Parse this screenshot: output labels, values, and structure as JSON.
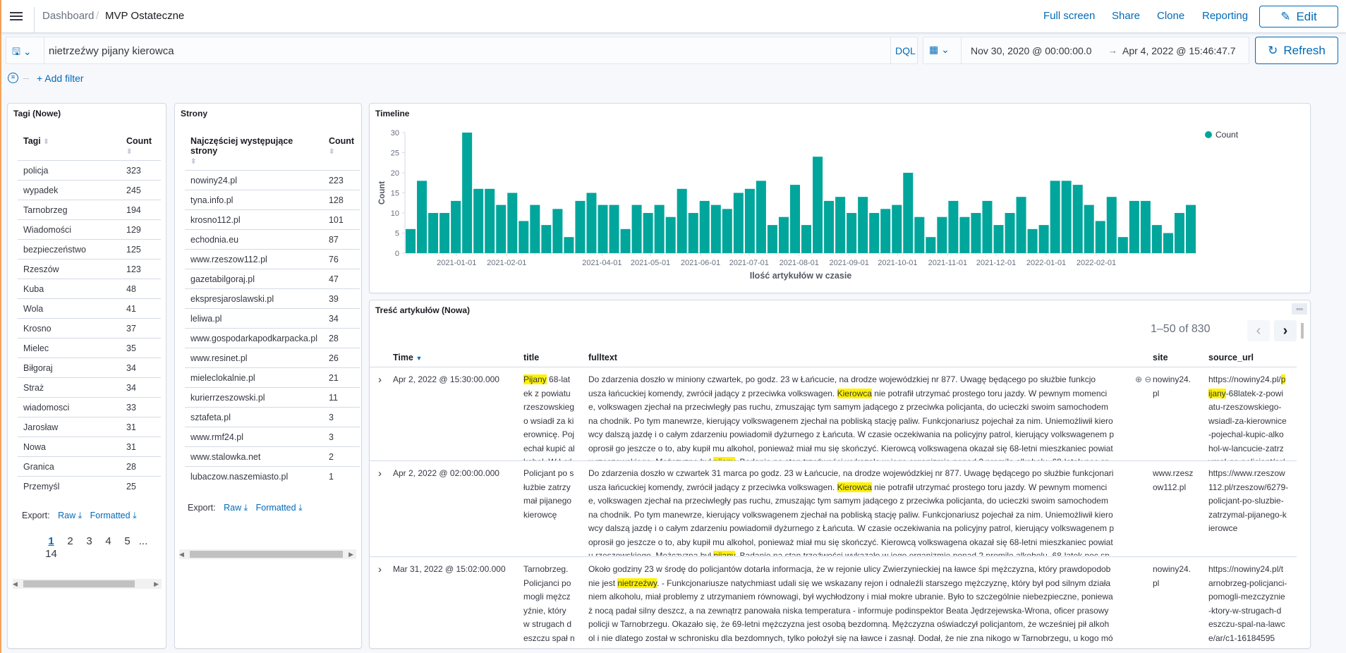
{
  "header": {
    "breadcrumb_root": "Dashboard",
    "breadcrumb_current": "MVP Ostateczne",
    "links": [
      "Full screen",
      "Share",
      "Clone",
      "Reporting"
    ],
    "edit_label": "Edit"
  },
  "query": {
    "value": "nietrzeźwy pijany kierowca",
    "language": "DQL",
    "time_from": "Nov 30, 2020 @ 00:00:00.0",
    "time_arrow": "→",
    "time_to": "Apr 4, 2022 @ 15:46:47.7",
    "refresh_label": "Refresh",
    "add_filter": "+ Add filter"
  },
  "tags_panel": {
    "title": "Tagi (Nowe)",
    "col1": "Tagi",
    "col2": "Count",
    "rows": [
      [
        "policja",
        "323"
      ],
      [
        "wypadek",
        "245"
      ],
      [
        "Tarnobrzeg",
        "194"
      ],
      [
        "Wiadomości",
        "129"
      ],
      [
        "bezpieczeństwo",
        "125"
      ],
      [
        "Rzeszów",
        "123"
      ],
      [
        "Kuba",
        "48"
      ],
      [
        "Wola",
        "41"
      ],
      [
        "Krosno",
        "37"
      ],
      [
        "Mielec",
        "35"
      ],
      [
        "Biłgoraj",
        "34"
      ],
      [
        "Straż",
        "34"
      ],
      [
        "wiadomosci",
        "33"
      ],
      [
        "Jarosław",
        "31"
      ],
      [
        "Nowa",
        "31"
      ],
      [
        "Granica",
        "28"
      ],
      [
        "Przemyśl",
        "25"
      ]
    ],
    "export_label": "Export:",
    "raw": "Raw",
    "formatted": "Formatted",
    "pages": [
      "1",
      "2",
      "3",
      "4",
      "5",
      "...",
      "14"
    ],
    "current_page": "1"
  },
  "sites_panel": {
    "title": "Strony",
    "col1": "Najczęściej występujące strony",
    "col2": "Count",
    "rows": [
      [
        "nowiny24.pl",
        "223"
      ],
      [
        "tyna.info.pl",
        "128"
      ],
      [
        "krosno112.pl",
        "101"
      ],
      [
        "echodnia.eu",
        "87"
      ],
      [
        "www.rzeszow112.pl",
        "76"
      ],
      [
        "gazetabilgoraj.pl",
        "47"
      ],
      [
        "ekspresjaroslawski.pl",
        "39"
      ],
      [
        "leliwa.pl",
        "34"
      ],
      [
        "www.gospodarkapodkarpacka.pl",
        "28"
      ],
      [
        "www.resinet.pl",
        "26"
      ],
      [
        "mieleclokalnie.pl",
        "21"
      ],
      [
        "kurierrzeszowski.pl",
        "11"
      ],
      [
        "sztafeta.pl",
        "3"
      ],
      [
        "www.rmf24.pl",
        "3"
      ],
      [
        "www.stalowka.net",
        "2"
      ],
      [
        "lubaczow.naszemiasto.pl",
        "1"
      ]
    ],
    "export_label": "Export:",
    "raw": "Raw",
    "formatted": "Formatted"
  },
  "timeline": {
    "title": "Timeline"
  },
  "chart_data": {
    "type": "bar",
    "ylabel": "Count",
    "xlabel": "Ilość artykułów w czasie",
    "legend": [
      "Count"
    ],
    "legend_position": "top-right",
    "color": "#00a69b",
    "ylim": [
      0,
      30
    ],
    "yticks": [
      0,
      5,
      10,
      15,
      20,
      25,
      30
    ],
    "x_start": "2020-11-30",
    "x_end": "2022-04-04",
    "interval": "week",
    "xtick_labels": [
      "2021-01-01",
      "2021-02-01",
      "2021-04-01",
      "2021-05-01",
      "2021-06-01",
      "2021-07-01",
      "2021-08-01",
      "2021-09-01",
      "2021-10-01",
      "2021-11-01",
      "2021-12-01",
      "2022-01-01",
      "2022-02-01"
    ],
    "values": [
      6,
      18,
      10,
      10,
      13,
      30,
      16,
      16,
      12,
      15,
      8,
      12,
      7,
      11,
      4,
      13,
      15,
      12,
      12,
      6,
      12,
      10,
      12,
      9,
      16,
      10,
      13,
      12,
      11,
      15,
      16,
      18,
      7,
      9,
      17,
      7,
      24,
      13,
      14,
      10,
      14,
      10,
      11,
      12,
      20,
      9,
      4,
      9,
      13,
      9,
      10,
      13,
      7,
      10,
      14,
      6,
      7,
      18,
      18,
      17,
      12,
      8,
      14,
      4,
      13,
      13,
      7,
      5,
      10,
      12
    ]
  },
  "articles": {
    "title": "Treść artykułów (Nowa)",
    "pagination": "1–50 of 830",
    "columns": [
      "Time",
      "title",
      "fulltext",
      "site",
      "source_url"
    ],
    "rows": [
      {
        "time": "Apr 2, 2022 @ 15:30:00.000",
        "title": [
          [
            {
              "hl": "Pijany"
            },
            " 68-lat"
          ],
          [
            "ek z powiatu"
          ],
          [
            "rzeszowskieg"
          ],
          [
            "o wsiadł za ki"
          ],
          [
            "erownicę. Poj"
          ],
          [
            "echał kupić al"
          ],
          [
            "kohol. W Łań"
          ]
        ],
        "fulltext": [
          [
            "Do zdarzenia doszło w miniony czwartek, po godz. 23 w Łańcucie, na drodze wojewódzkiej nr 877. Uwagę będącego po służbie funkcjo"
          ],
          [
            "usza łańcuckiej komendy, zwrócił jadący z przeciwka volkswagen. ",
            {
              "hl": "Kierowca"
            },
            " nie potrafił utrzymać prostego toru jazdy. W pewnym momenci"
          ],
          [
            "e, volkswagen zjechał na przeciwległy pas ruchu, zmuszając tym samym jadącego z przeciwka policjanta, do ucieczki swoim samochodem"
          ],
          [
            "na chodnik. Po tym manewrze, kierujący volkswagenem zjechał na pobliską stację paliw. Funkcjonariusz pojechał za nim. Uniemożliwił kiero"
          ],
          [
            "wcy dalszą jazdę i o całym zdarzeniu powiadomił dyżurnego z Łańcuta. W czasie oczekiwania na policyjny patrol, kierujący volkswagenem p"
          ],
          [
            "oprosił go jeszcze o to, aby kupił mu alkohol, ponieważ miał mu się skończyć. Kierowcą volkswagena okazał się 68-letni mieszkaniec powiat"
          ],
          [
            "u rzeszowskiego. Mężczyzna był ",
            {
              "hl": "pijany"
            },
            ". Badanie na stan trzeźwości wykazało w jego organizmie ponad 2 promile alkoholu. 68-latek noc sp"
          ]
        ],
        "site": [
          [
            "nowiny24."
          ],
          [
            "pl"
          ]
        ],
        "url": [
          [
            "https://nowiny24.pl/",
            {
              "hl": "p"
            }
          ],
          [
            {
              "hl": "ijany"
            },
            "-68latek-z-powi"
          ],
          [
            "atu-rzeszowskiego-"
          ],
          [
            "wsiadl-za-kierownice"
          ],
          [
            "-pojechal-kupic-alko"
          ],
          [
            "hol-w-lancucie-zatrz"
          ],
          [
            "ymal-go-policjant/ar/"
          ]
        ]
      },
      {
        "time": "Apr 2, 2022 @ 02:00:00.000",
        "title": [
          [
            "Policjant po s"
          ],
          [
            "łużbie zatrzy"
          ],
          [
            "mał pijanego"
          ],
          [
            "kierowcę"
          ]
        ],
        "fulltext": [
          [
            "Do zdarzenia doszło w czwartek 31 marca po godz. 23 w Łańcucie, na drodze wojewódzkiej nr 877. Uwagę będącego po służbie funkcjonari"
          ],
          [
            "usza łańcuckiej komendy, zwrócił jadący z przeciwka volkswagen. ",
            {
              "hl": "Kierowca"
            },
            " nie potrafił utrzymać prostego toru jazdy. W pewnym momenci"
          ],
          [
            "e, volkswagen zjechał na przeciwległy pas ruchu, zmuszając tym samym jadącego z przeciwka policjanta, do ucieczki swoim samochodem"
          ],
          [
            "na chodnik. Po tym manewrze, kierujący volkswagenem zjechał na pobliską stację paliw. Funkcjonariusz pojechał za nim. Uniemożliwił kiero"
          ],
          [
            "wcy dalszą jazdę i o całym zdarzeniu powiadomił dyżurnego z Łańcuta. W czasie oczekiwania na policyjny patrol, kierujący volkswagenem p"
          ],
          [
            "oprosił go jeszcze o to, aby kupił mu alkohol, ponieważ miał mu się skończyć. Kierowcą volkswagena okazał się 68-letni mieszkaniec powiat"
          ],
          [
            "u rzeszowskiego. Mężczyzna był ",
            {
              "hl": "pijany"
            },
            ". Badanie na stan trzeźwości wykazało w jego organizmie ponad 2 promile alkoholu. 68-latek noc sp"
          ]
        ],
        "site": [
          [
            "www.rzesz"
          ],
          [
            "ow112.pl"
          ]
        ],
        "url": [
          [
            "https://www.rzeszow"
          ],
          [
            "112.pl/rzeszow/6279-"
          ],
          [
            "policjant-po-sluzbie-"
          ],
          [
            "zatrzymal-pijanego-k"
          ],
          [
            "ierowce"
          ]
        ]
      },
      {
        "time": "Mar 31, 2022 @ 15:02:00.000",
        "title": [
          [
            "Tarnobrzeg."
          ],
          [
            "Policjanci po"
          ],
          [
            "mogli mężcz"
          ],
          [
            "yźnie, który"
          ],
          [
            "w strugach d"
          ],
          [
            "eszczu spał n"
          ],
          [
            "a ławce"
          ]
        ],
        "fulltext": [
          [
            "Około godziny 23 w środę do policjantów dotarła informacja, że w rejonie ulicy Zwierzynieckiej na ławce śpi mężczyzna, który prawdopodob"
          ],
          [
            "nie jest ",
            {
              "hl": "nietrzeźwy"
            },
            ". - Funkcjonariusze natychmiast udali się we wskazany rejon i odnaleźli starszego mężczyznę, który był pod silnym działa"
          ],
          [
            "niem alkoholu, miał problemy z utrzymaniem równowagi, był wychłodzony i miał mokre ubranie. Było to szczególnie niebezpieczne, poniewa"
          ],
          [
            "ż nocą padał silny deszcz, a na zewnątrz panowała niska temperatura - informuje podinspektor Beata Jędrzejewska-Wrona, oficer prasowy"
          ],
          [
            "policji w Tarnobrzegu. Okazało się, że 69-letni mężczyzna jest osobą bezdomną. Mężczyzna oświadczył policjantom, że wcześniej pił alkoh"
          ],
          [
            "ol i nie dlatego został w schronisku dla bezdomnych, tylko położył się na ławce i zasnął. Dodał, że nie zna nikogo w Tarnobrzegu, u kogo mó"
          ],
          [
            "głby się zatrzymać. Mężczyzna miał sine usta i drżał z zimna. Funkcjonariusze udzielili pomocy seniorowi, ogrzali w radiowozie i przewieźli d"
          ]
        ],
        "site": [
          [
            "nowiny24."
          ],
          [
            "pl"
          ]
        ],
        "url": [
          [
            "https://nowiny24.pl/t"
          ],
          [
            "arnobrzeg-policjanci-"
          ],
          [
            "pomogli-mezczyznie"
          ],
          [
            "-ktory-w-strugach-d"
          ],
          [
            "eszczu-spal-na-lawc"
          ],
          [
            "e/ar/c1-16184595"
          ]
        ]
      }
    ]
  },
  "colors": {
    "accent": "#006bb8",
    "bar": "#00a69b",
    "highlight": "#fff200"
  }
}
